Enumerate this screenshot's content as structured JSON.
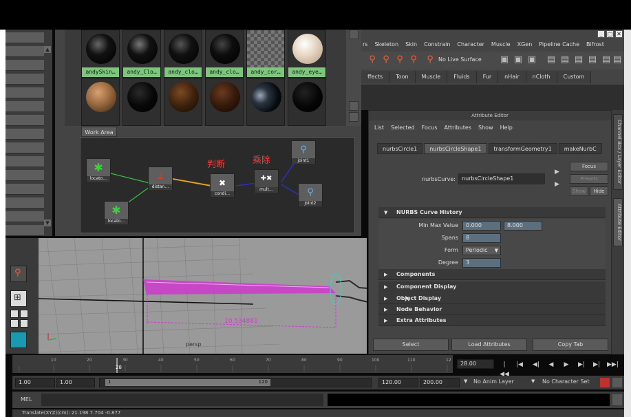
{
  "hypershade": {
    "swatches_row1": [
      "andySkin…",
      "andy_Clo…",
      "andy_clo…",
      "andy_clo…",
      "andy_cor…",
      "andy_eye…"
    ],
    "work_area_tab": "Work Area",
    "nodes": {
      "locator_a": "locato…",
      "locator_b": "locato…",
      "distance": "distan…",
      "condition": "condi…",
      "multiply": "mult…",
      "joint1": "joint1",
      "joint2": "joint2"
    },
    "annotations": {
      "condition": "判断",
      "divide": "乘除"
    }
  },
  "main_menu": [
    "rs",
    "Skeleton",
    "Skin",
    "Constrain",
    "Character",
    "Muscle",
    "XGen",
    "Pipeline Cache",
    "Bifrost"
  ],
  "status_line": {
    "live_surface": "No Live Surface"
  },
  "shelf_tabs": [
    "ffects",
    "Toon",
    "Muscle",
    "Fluids",
    "Fur",
    "nHair",
    "nCloth",
    "Custom"
  ],
  "attribute_editor": {
    "title": "Attribute Editor",
    "menu": [
      "List",
      "Selected",
      "Focus",
      "Attributes",
      "Show",
      "Help"
    ],
    "tabs": [
      "nurbsCircle1",
      "nurbsCircleShape1",
      "transformGeometry1",
      "makeNurbC"
    ],
    "node_label": "nurbsCurve:",
    "node_value": "nurbsCircleShape1",
    "focus_btn": "Focus",
    "presets_btn": "Presets",
    "show_btn": "Show",
    "hide_btn": "Hide",
    "curve_history": {
      "title": "NURBS Curve History",
      "min_max_label": "Min Max Value",
      "min_value": "0.000",
      "max_value": "8.000",
      "spans_label": "Spans",
      "spans_value": "8",
      "form_label": "Form",
      "form_value": "Periodic",
      "degree_label": "Degree",
      "degree_value": "3"
    },
    "sections": [
      "Components",
      "Component Display",
      "Object Display",
      "Node Behavior",
      "Extra Attributes"
    ],
    "bottom_buttons": [
      "Select",
      "Load Attributes",
      "Copy Tab"
    ]
  },
  "side_tabs": [
    "Channel Box / Layer Editor",
    "Attribute Editor"
  ],
  "viewport": {
    "camera": "persp",
    "measure": "10.534881"
  },
  "timeline": {
    "ticks": [
      "10",
      "20",
      "28",
      "30",
      "40",
      "50",
      "60",
      "70",
      "80",
      "90",
      "100",
      "110",
      "12"
    ],
    "current_time": "28.00"
  },
  "range": {
    "start": "1.00",
    "play_start": "1.00",
    "slider_start": "1",
    "slider_end": "120",
    "play_end": "120.00",
    "end": "200.00",
    "anim_layer": "No Anim Layer",
    "char_set": "No Character Set"
  },
  "command": {
    "label": "MEL"
  },
  "status": {
    "text": "Translate(XYZ)(cm):   21.198    7.704    -0.877"
  },
  "colors": {
    "accent_red": "#ff3a3a",
    "swatch_label": "#7ec67e",
    "curve_magenta": "#d63ad6"
  }
}
